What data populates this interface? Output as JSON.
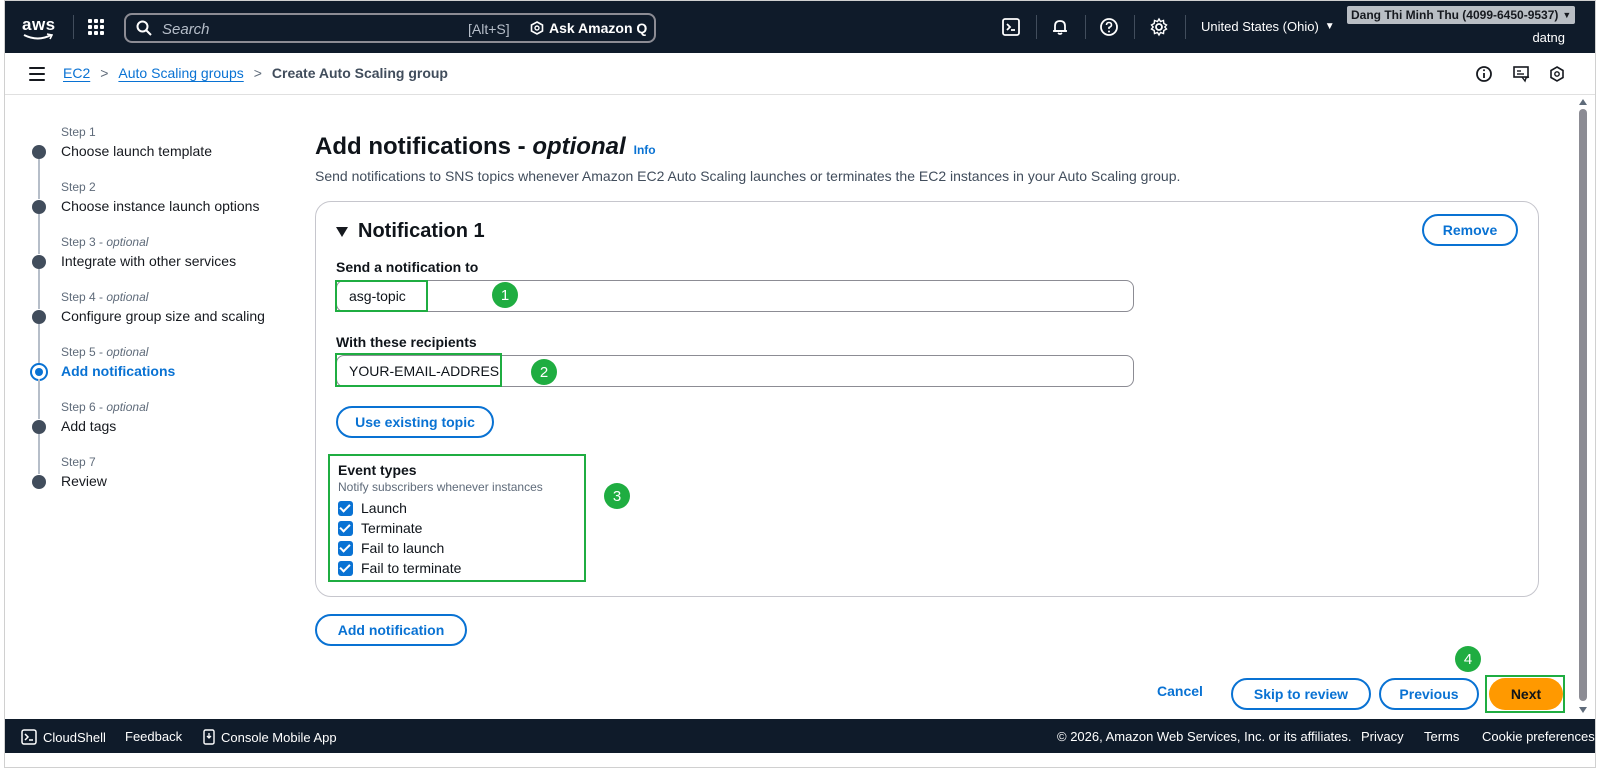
{
  "topnav": {
    "logo_text": "aws",
    "search_placeholder": "Search",
    "search_shortcut": "[Alt+S]",
    "ask_q": "Ask Amazon Q",
    "region": "United States (Ohio)",
    "account": "Dang Thi Minh Thu (4099-6450-9537)",
    "username": "datng"
  },
  "breadcrumb": {
    "items": [
      "EC2",
      "Auto Scaling groups"
    ],
    "current": "Create Auto Scaling group"
  },
  "steps": [
    {
      "label": "Step 1",
      "optional": "",
      "title": "Choose launch template"
    },
    {
      "label": "Step 2",
      "optional": "",
      "title": "Choose instance launch options"
    },
    {
      "label": "Step 3",
      "optional": "optional",
      "title": "Integrate with other services"
    },
    {
      "label": "Step 4",
      "optional": "optional",
      "title": "Configure group size and scaling"
    },
    {
      "label": "Step 5",
      "optional": "optional",
      "title": "Add notifications"
    },
    {
      "label": "Step 6",
      "optional": "optional",
      "title": "Add tags"
    },
    {
      "label": "Step 7",
      "optional": "",
      "title": "Review"
    }
  ],
  "main": {
    "title": "Add notifications - ",
    "title_optional": "optional",
    "info": "Info",
    "description": "Send notifications to SNS topics whenever Amazon EC2 Auto Scaling launches or terminates the EC2 instances in your Auto Scaling group."
  },
  "notification": {
    "header": "Notification 1",
    "remove": "Remove",
    "send_label": "Send a notification to",
    "send_value": "asg-topic",
    "recipients_label": "With these recipients",
    "recipients_value": "YOUR-EMAIL-ADDRES",
    "use_existing": "Use existing topic",
    "event_title": "Event types",
    "event_desc": "Notify subscribers whenever instances",
    "events": [
      "Launch",
      "Terminate",
      "Fail to launch",
      "Fail to terminate"
    ]
  },
  "actions": {
    "add_notification": "Add notification",
    "cancel": "Cancel",
    "skip": "Skip to review",
    "previous": "Previous",
    "next": "Next"
  },
  "badges": [
    "1",
    "2",
    "3",
    "4"
  ],
  "footer": {
    "cloudshell": "CloudShell",
    "feedback": "Feedback",
    "mobile": "Console Mobile App",
    "copyright": "© 2026, Amazon Web Services, Inc. or its affiliates.",
    "privacy": "Privacy",
    "terms": "Terms",
    "cookies": "Cookie preferences"
  },
  "colors": {
    "nav_bg": "#0f1b2a",
    "link": "#0972d3",
    "primary": "#ff9900",
    "highlight": "#1fad41"
  }
}
